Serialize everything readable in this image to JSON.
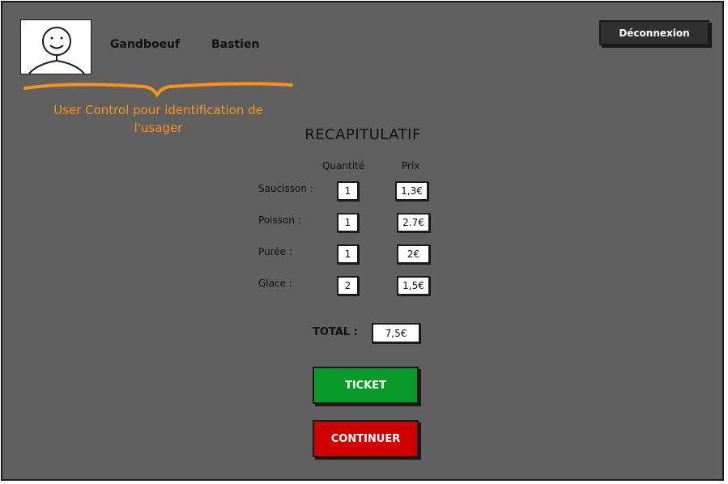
{
  "user": {
    "first_name": "Gandboeuf",
    "last_name": "Bastien"
  },
  "header": {
    "logout_label": "Déconnexion"
  },
  "annotation": {
    "line1": "User Control pour identification de",
    "line2": "l'usager",
    "color": "#f7941d"
  },
  "summary": {
    "title": "RECAPITULATIF",
    "col_quantity": "Quantité",
    "col_price": "Prix",
    "items": [
      {
        "label": "Saucisson :",
        "qty": "1",
        "price": "1,3€"
      },
      {
        "label": "Poisson :",
        "qty": "1",
        "price": "2.7€"
      },
      {
        "label": "Purée :",
        "qty": "1",
        "price": "2€"
      },
      {
        "label": "Glace :",
        "qty": "2",
        "price": "1,5€"
      }
    ],
    "total_label": "TOTAL :",
    "total_value": "7,5€"
  },
  "actions": {
    "ticket_label": "TICKET",
    "continue_label": "CONTINUER",
    "ticket_color": "#0a9a2a",
    "continue_color": "#d10000"
  }
}
